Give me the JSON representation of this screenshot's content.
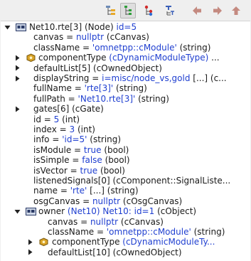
{
  "toolbar": {
    "buttons": [
      {
        "name": "group-by-category-button",
        "icon": "category-icon",
        "pressed": false
      },
      {
        "name": "inheritance-mode-button",
        "icon": "inheritance-icon",
        "pressed": true
      },
      {
        "name": "children-mode-button",
        "icon": "children-icon",
        "pressed": false
      },
      {
        "name": "flat-mode-button",
        "icon": "flat-icon",
        "pressed": false
      },
      {
        "name": "back-button",
        "icon": "arrow-left-icon",
        "pressed": false
      },
      {
        "name": "forward-button",
        "icon": "arrow-right-icon",
        "pressed": false
      },
      {
        "name": "parent-button",
        "icon": "arrow-up-icon",
        "pressed": false
      }
    ]
  },
  "tree": {
    "rows": [
      {
        "segments": [
          {
            "t": "Net10.rte[3] (Node) ",
            "c": "k"
          },
          {
            "t": "id=5",
            "c": "b"
          }
        ],
        "expander": "expanded",
        "icon": "module",
        "indent": 0
      },
      {
        "segments": [
          {
            "t": "canvas = ",
            "c": "k"
          },
          {
            "t": "nullptr",
            "c": "b"
          },
          {
            "t": " (cCanvas)",
            "c": "k"
          }
        ],
        "expander": "none",
        "icon": "",
        "indent": 1
      },
      {
        "segments": [
          {
            "t": "className = ",
            "c": "k"
          },
          {
            "t": "'omnetpp::cModule'",
            "c": "b"
          },
          {
            "t": " (string)",
            "c": "k"
          }
        ],
        "expander": "none",
        "icon": "",
        "indent": 1
      },
      {
        "segments": [
          {
            "t": "componentType ",
            "c": "k"
          },
          {
            "t": "(cDynamicModuleType)",
            "c": "b"
          },
          {
            "t": " ...",
            "c": "k"
          }
        ],
        "expander": "collapsed",
        "icon": "component",
        "indent": 1
      },
      {
        "segments": [
          {
            "t": "defaultList[5] (cOwnedObject)",
            "c": "k"
          }
        ],
        "expander": "collapsed",
        "icon": "",
        "indent": 1
      },
      {
        "segments": [
          {
            "t": "displayString = ",
            "c": "k"
          },
          {
            "t": "i=misc/node_vs,gold",
            "c": "b"
          },
          {
            "t": " [...]  (c...",
            "c": "k"
          }
        ],
        "expander": "collapsed",
        "icon": "",
        "indent": 1
      },
      {
        "segments": [
          {
            "t": "fullName = ",
            "c": "k"
          },
          {
            "t": "'rte[3]'",
            "c": "b"
          },
          {
            "t": " (string)",
            "c": "k"
          }
        ],
        "expander": "none",
        "icon": "",
        "indent": 1
      },
      {
        "segments": [
          {
            "t": "fullPath = ",
            "c": "k"
          },
          {
            "t": "'Net10.rte[3]'",
            "c": "b"
          },
          {
            "t": " (string)",
            "c": "k"
          }
        ],
        "expander": "none",
        "icon": "",
        "indent": 1
      },
      {
        "segments": [
          {
            "t": "gates[6] (cGate)",
            "c": "k"
          }
        ],
        "expander": "collapsed",
        "icon": "",
        "indent": 1
      },
      {
        "segments": [
          {
            "t": "id = ",
            "c": "k"
          },
          {
            "t": "5",
            "c": "b"
          },
          {
            "t": " (int)",
            "c": "k"
          }
        ],
        "expander": "none",
        "icon": "",
        "indent": 1
      },
      {
        "segments": [
          {
            "t": "index = ",
            "c": "k"
          },
          {
            "t": "3",
            "c": "b"
          },
          {
            "t": " (int)",
            "c": "k"
          }
        ],
        "expander": "none",
        "icon": "",
        "indent": 1
      },
      {
        "segments": [
          {
            "t": "info = ",
            "c": "k"
          },
          {
            "t": "'id=5'",
            "c": "b"
          },
          {
            "t": " (string)",
            "c": "k"
          }
        ],
        "expander": "none",
        "icon": "",
        "indent": 1
      },
      {
        "segments": [
          {
            "t": "isModule = ",
            "c": "k"
          },
          {
            "t": "true",
            "c": "b"
          },
          {
            "t": " (bool)",
            "c": "k"
          }
        ],
        "expander": "none",
        "icon": "",
        "indent": 1
      },
      {
        "segments": [
          {
            "t": "isSimple = ",
            "c": "k"
          },
          {
            "t": "false",
            "c": "b"
          },
          {
            "t": " (bool)",
            "c": "k"
          }
        ],
        "expander": "none",
        "icon": "",
        "indent": 1
      },
      {
        "segments": [
          {
            "t": "isVector = ",
            "c": "k"
          },
          {
            "t": "true",
            "c": "b"
          },
          {
            "t": " (bool)",
            "c": "k"
          }
        ],
        "expander": "none",
        "icon": "",
        "indent": 1
      },
      {
        "segments": [
          {
            "t": "listenedSignals[0] (cComponent::SignalListe...",
            "c": "k"
          }
        ],
        "expander": "none",
        "icon": "",
        "indent": 1
      },
      {
        "segments": [
          {
            "t": "name = ",
            "c": "k"
          },
          {
            "t": "'rte'",
            "c": "b"
          },
          {
            "t": " [...]  (string)",
            "c": "k"
          }
        ],
        "expander": "none",
        "icon": "",
        "indent": 1
      },
      {
        "segments": [
          {
            "t": "osgCanvas = ",
            "c": "k"
          },
          {
            "t": "nullptr",
            "c": "b"
          },
          {
            "t": " (cOsgCanvas)",
            "c": "k"
          }
        ],
        "expander": "none",
        "icon": "",
        "indent": 1
      },
      {
        "segments": [
          {
            "t": "owner ",
            "c": "k"
          },
          {
            "t": "(Net10) Net10: id=1",
            "c": "b"
          },
          {
            "t": " (cObject)",
            "c": "k"
          }
        ],
        "expander": "expanded",
        "icon": "module",
        "indent": 1
      },
      {
        "segments": [
          {
            "t": "canvas = ",
            "c": "k"
          },
          {
            "t": "nullptr",
            "c": "b"
          },
          {
            "t": " (cCanvas)",
            "c": "k"
          }
        ],
        "expander": "none",
        "icon": "",
        "indent": 2
      },
      {
        "segments": [
          {
            "t": "className = ",
            "c": "k"
          },
          {
            "t": "'omnetpp::cModule'",
            "c": "b"
          },
          {
            "t": " (string)",
            "c": "k"
          }
        ],
        "expander": "none",
        "icon": "",
        "indent": 2
      },
      {
        "segments": [
          {
            "t": "componentType ",
            "c": "k"
          },
          {
            "t": "(cDynamicModuleTy...",
            "c": "b"
          }
        ],
        "expander": "collapsed",
        "icon": "component",
        "indent": 2
      },
      {
        "segments": [
          {
            "t": "defaultList[10] (cOwnedObject)",
            "c": "k"
          }
        ],
        "expander": "collapsed",
        "icon": "",
        "indent": 2
      }
    ]
  }
}
